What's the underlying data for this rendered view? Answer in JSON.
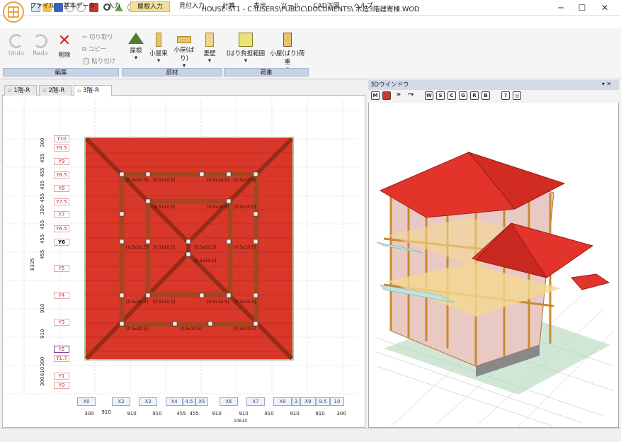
{
  "window": {
    "title": "HOUSE-ST1 - C:\\USERS\\PUBLIC\\DOCUMENTS\\ 木造3階建寄棟.WOD",
    "minimize": "─",
    "maximize": "☐",
    "close": "✕"
  },
  "menu": [
    "ファイル",
    "基本データ",
    "入力",
    "屋根入力",
    "見付入力",
    "計算",
    "表示",
    "ツール",
    "CAD下図",
    "ヘルプ"
  ],
  "ribbon": {
    "edit": {
      "undo": "Undo",
      "redo": "Redo",
      "delete": "削除",
      "cut": "切り取り",
      "copy": "コピー",
      "paste": "貼り付け",
      "label": "編集"
    },
    "parts": {
      "roof": "屋根",
      "koya_tsuka": "小屋束",
      "koya_hari": "小屋(ばり)",
      "tsuma": "妻壁",
      "label": "部材"
    },
    "load": {
      "hari_range": "(はり負担範囲",
      "koya_load": "小屋(ばり)荷重",
      "label": "荷重"
    }
  },
  "tabs": [
    "1階-R",
    "2階-R",
    "3階-R"
  ],
  "active_tab": "3階-R",
  "right_panel": {
    "title": "3Dウインドウ",
    "toolbar": [
      "M",
      "■",
      "»",
      "⤳",
      "W",
      "S",
      "C",
      "G",
      "R",
      "B",
      "?",
      "◎"
    ]
  },
  "plan": {
    "y_labels": [
      "Y10",
      "Y9.5",
      "Y9",
      "Y8.5",
      "Y8",
      "Y7.5",
      "Y7",
      "Y6.5",
      "Y6",
      "Y5",
      "Y4",
      "Y3",
      "Y2",
      "Y1.7",
      "Y1",
      "Y0"
    ],
    "y_dims": [
      "300",
      "455",
      "455",
      "455",
      "455",
      "300",
      "455",
      "455",
      "455",
      "910",
      "910",
      "300",
      "610",
      "300"
    ],
    "y_total": "8335",
    "x_labels": [
      "X0",
      "X2",
      "X3",
      "X4",
      "4.5",
      "X5",
      "X6",
      "X7",
      "X8",
      "3",
      "X9",
      "9.5",
      "10"
    ],
    "x_dims": [
      "300",
      "910",
      "910",
      "910",
      "455",
      "455",
      "910",
      "910",
      "910",
      "910",
      "910",
      "300"
    ],
    "x_total": "10610",
    "member_label": "[0.5x10.5]"
  },
  "colors": {
    "roof": "#d9372a",
    "accent": "#f3df9a",
    "grid": "#c8c8c8"
  }
}
